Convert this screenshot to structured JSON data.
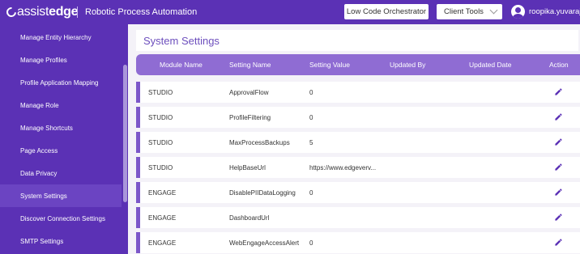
{
  "header": {
    "logo_text_light": "assist",
    "logo_text_bold": "edge",
    "app_title": "Robotic Process Automation",
    "low_code_button": "Low Code Orchestrator",
    "client_tools_button": "Client Tools",
    "username": "roopika.yuvaraj",
    "brand_color": "#5b31b5"
  },
  "sidebar": {
    "items": [
      {
        "label": "Manage Entity Hierarchy"
      },
      {
        "label": "Manage Profiles"
      },
      {
        "label": "Profile Application Mapping"
      },
      {
        "label": "Manage Role"
      },
      {
        "label": "Manage Shortcuts"
      },
      {
        "label": "Page Access"
      },
      {
        "label": "Data Privacy"
      },
      {
        "label": "System Settings"
      },
      {
        "label": "Discover Connection Settings"
      },
      {
        "label": "SMTP Settings"
      }
    ],
    "active": "System Settings"
  },
  "main": {
    "title": "System Settings",
    "columns": [
      "Module Name",
      "Setting Name",
      "Setting Value",
      "Updated By",
      "Updated Date",
      "Action"
    ],
    "rows": [
      {
        "module": "STUDIO",
        "setting": "ApprovalFlow",
        "value": "0",
        "updated_by": "",
        "updated_date": ""
      },
      {
        "module": "STUDIO",
        "setting": "ProfileFiltering",
        "value": "0",
        "updated_by": "",
        "updated_date": ""
      },
      {
        "module": "STUDIO",
        "setting": "MaxProcessBackups",
        "value": "5",
        "updated_by": "",
        "updated_date": ""
      },
      {
        "module": "STUDIO",
        "setting": "HelpBaseUrl",
        "value": "https://www.edgeverv...",
        "updated_by": "",
        "updated_date": ""
      },
      {
        "module": "ENGAGE",
        "setting": "DisablePIIDataLogging",
        "value": "0",
        "updated_by": "",
        "updated_date": ""
      },
      {
        "module": "ENGAGE",
        "setting": "DashboardUrl",
        "value": "",
        "updated_by": "",
        "updated_date": ""
      },
      {
        "module": "ENGAGE",
        "setting": "WebEngageAccessAlert",
        "value": "0",
        "updated_by": "",
        "updated_date": ""
      }
    ],
    "action_icon": "pencil-icon",
    "accent_color": "#7c57c9"
  }
}
